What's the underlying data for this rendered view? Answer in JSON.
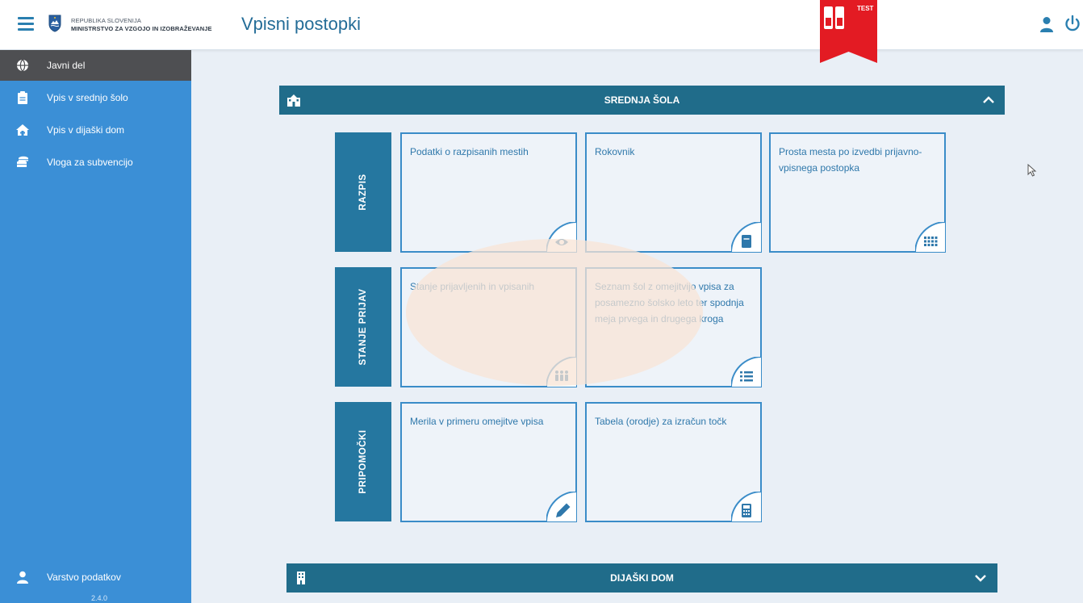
{
  "header": {
    "org_line1": "REPUBLIKA SLOVENIJA",
    "org_line2": "MINISTRSTVO ZA VZGOJO IN IZOBRAŽEVANJE",
    "page_title": "Vpisni postopki",
    "badge_text": "TEST"
  },
  "sidebar": {
    "items": [
      {
        "label": "Javni del",
        "icon": "globe-icon",
        "active": true
      },
      {
        "label": "Vpis v srednjo šolo",
        "icon": "document-icon",
        "active": false
      },
      {
        "label": "Vpis v dijaški dom",
        "icon": "house-icon",
        "active": false
      },
      {
        "label": "Vloga za subvencijo",
        "icon": "coins-icon",
        "active": false
      }
    ],
    "privacy_label": "Varstvo podatkov",
    "version": "2.4.0"
  },
  "main": {
    "panel1": {
      "title": "SREDNJA ŠOLA",
      "expanded": true,
      "sections": [
        {
          "label": "RAZPIS",
          "tiles": [
            {
              "text": "Podatki o razpisanih mestih",
              "icon": "eye-icon"
            },
            {
              "text": "Rokovnik",
              "icon": "book-icon"
            },
            {
              "text": "Prosta mesta po izvedbi prijavno-vpisnega postopka",
              "icon": "grid-icon"
            }
          ]
        },
        {
          "label": "STANJE PRIJAV",
          "tiles": [
            {
              "text": "Stanje prijavljenih in vpisanih",
              "icon": "people-icon"
            },
            {
              "text": "Seznam šol z omejitvijo vpisa za posamezno šolsko leto ter spodnja meja prvega in drugega kroga",
              "icon": "list-icon"
            }
          ]
        },
        {
          "label": "PRIPOMOČKI",
          "tiles": [
            {
              "text": "Merila v primeru omejitve vpisa",
              "icon": "pencil-icon"
            },
            {
              "text": "Tabela (orodje) za izračun točk",
              "icon": "calculator-icon"
            }
          ]
        }
      ]
    },
    "panel2": {
      "title": "DIJAŠKI DOM",
      "expanded": false
    }
  },
  "colors": {
    "sidebar": "#3b8fd6",
    "sidebar_active": "#4e4f52",
    "panel_header": "#206c8a",
    "section_label": "#2577a0",
    "tile_border": "#3a8cc8",
    "title_text": "#236c97",
    "badge": "#e31b23"
  }
}
